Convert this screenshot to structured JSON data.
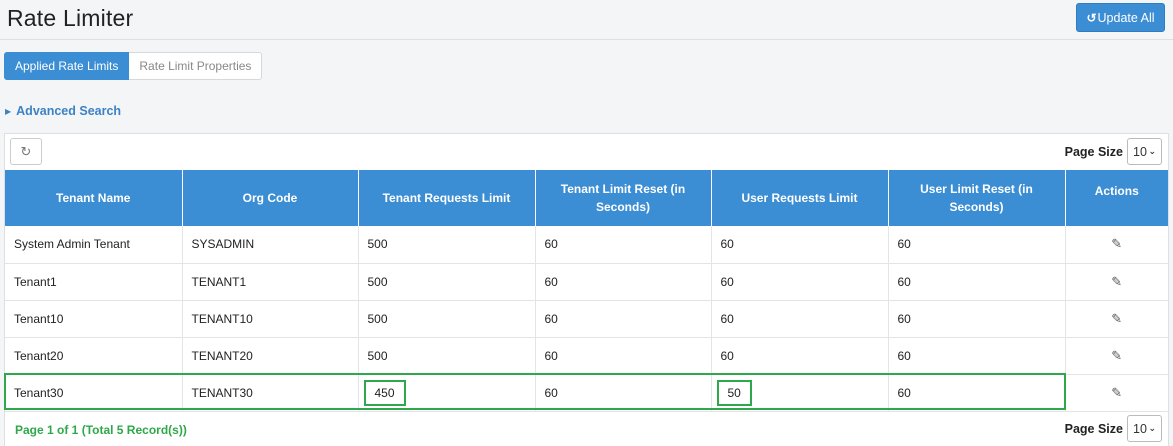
{
  "header": {
    "title": "Rate Limiter",
    "update_all_label": "Update All",
    "update_all_icon": "undo-icon"
  },
  "tabs": [
    {
      "label": "Applied Rate Limits",
      "active": true
    },
    {
      "label": "Rate Limit Properties",
      "active": false
    }
  ],
  "advanced_search": {
    "label": "Advanced Search"
  },
  "toolbar": {
    "refresh_icon": "refresh-icon",
    "page_size_label": "Page Size",
    "page_size_value": "10"
  },
  "table": {
    "columns": [
      "Tenant Name",
      "Org Code",
      "Tenant Requests Limit",
      "Tenant Limit Reset (in Seconds)",
      "User Requests Limit",
      "User Limit Reset (in Seconds)",
      "Actions"
    ],
    "rows": [
      {
        "tenant_name": "System Admin Tenant",
        "org_code": "SYSADMIN",
        "tenant_requests_limit": "500",
        "tenant_limit_reset": "60",
        "user_requests_limit": "60",
        "user_limit_reset": "60"
      },
      {
        "tenant_name": "Tenant1",
        "org_code": "TENANT1",
        "tenant_requests_limit": "500",
        "tenant_limit_reset": "60",
        "user_requests_limit": "60",
        "user_limit_reset": "60"
      },
      {
        "tenant_name": "Tenant10",
        "org_code": "TENANT10",
        "tenant_requests_limit": "500",
        "tenant_limit_reset": "60",
        "user_requests_limit": "60",
        "user_limit_reset": "60"
      },
      {
        "tenant_name": "Tenant20",
        "org_code": "TENANT20",
        "tenant_requests_limit": "500",
        "tenant_limit_reset": "60",
        "user_requests_limit": "60",
        "user_limit_reset": "60"
      },
      {
        "tenant_name": "Tenant30",
        "org_code": "TENANT30",
        "tenant_requests_limit": "450",
        "tenant_limit_reset": "60",
        "user_requests_limit": "50",
        "user_limit_reset": "60"
      }
    ]
  },
  "footer": {
    "status": "Page 1 of 1 (Total 5 Record(s))",
    "page_size_label": "Page Size",
    "page_size_value": "10"
  },
  "colors": {
    "primary": "#3b8dd4",
    "highlight": "#2ea84a"
  }
}
